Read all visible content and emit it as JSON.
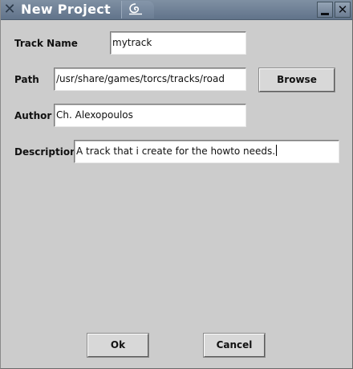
{
  "window": {
    "title": "New Project"
  },
  "form": {
    "track_name": {
      "label": "Track Name",
      "value": "mytrack"
    },
    "path": {
      "label": "Path",
      "value": "/usr/share/games/torcs/tracks/road"
    },
    "author": {
      "label": "Author",
      "value": "Ch. Alexopoulos"
    },
    "description": {
      "label": "Description",
      "value": "A track that i create for the howto needs."
    }
  },
  "buttons": {
    "browse": "Browse",
    "ok": "Ok",
    "cancel": "Cancel"
  },
  "icons": [
    "close-x-icon",
    "swirl-logo-icon",
    "minimize-icon",
    "close-icon"
  ]
}
